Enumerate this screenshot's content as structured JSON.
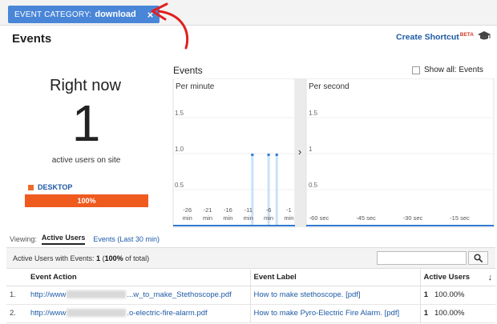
{
  "filter": {
    "key": "EVENT CATEGORY:",
    "value": "download",
    "close": "×"
  },
  "page": {
    "title": "Events",
    "create_shortcut": "Create Shortcut",
    "beta": "BETA"
  },
  "realtime": {
    "right_now": "Right now",
    "count": "1",
    "active_label": "active users on site",
    "device": {
      "label": "DESKTOP",
      "percent_text": "100%",
      "percent": 100
    }
  },
  "chart": {
    "title": "Events",
    "show_all": "Show all: Events",
    "per_minute": "Per minute",
    "per_second": "Per second",
    "expand_glyph": "›",
    "y_ticks": [
      "1.5",
      "1.0",
      "0.5"
    ],
    "minute_ticks": [
      "-26",
      "-21",
      "-16",
      "-11",
      "-6",
      "-1"
    ],
    "minute_unit": "min",
    "second_ticks": [
      "-60 sec",
      "-45 sec",
      "-30 sec",
      "-15 sec"
    ],
    "second_y_ticks": [
      "1.5",
      "1",
      "0.5"
    ],
    "colors": {
      "bar": "#c9e2fb",
      "bar_top": "#2f7bd2",
      "baseline": "#2f7bd2",
      "divider": "#e0e0e0"
    }
  },
  "chart_data": {
    "type": "bar",
    "title": "Events",
    "xlabel": "",
    "ylabel": "",
    "ylim": [
      0,
      1.5
    ],
    "x": [
      -29,
      -28,
      -27,
      -26,
      -25,
      -24,
      -23,
      -22,
      -21,
      -20,
      -19,
      -18,
      -17,
      -16,
      -15,
      -14,
      -13,
      -12,
      -11,
      -10,
      -9,
      -8,
      -7,
      -6,
      -5,
      -4,
      -3,
      -2,
      -1,
      0
    ],
    "values": [
      0,
      0,
      0,
      0,
      0,
      0,
      0,
      0,
      0,
      0,
      0,
      0,
      0,
      0,
      0,
      0,
      0,
      0,
      0,
      1,
      0,
      0,
      0,
      1,
      0,
      1,
      0,
      0,
      0,
      0
    ],
    "x_tick_labels": [
      "-26 min",
      "-21 min",
      "-16 min",
      "-11 min",
      "-6 min",
      "-1 min"
    ],
    "y_tick_labels": [
      "1.5",
      "1.0",
      "0.5"
    ],
    "grid": true
  },
  "viewing": {
    "label": "Viewing:",
    "active_tab": "Active Users",
    "other_tab": "Events (Last 30 min)"
  },
  "summary": {
    "prefix": "Active Users with Events:",
    "count": "1",
    "pct_open": "(",
    "pct": "100%",
    "pct_rest": " of total)"
  },
  "table": {
    "headers": {
      "action": "Event Action",
      "label": "Event Label",
      "users": "Active Users",
      "sort": "↓"
    },
    "rows": [
      {
        "num": "1.",
        "action_a": "http://www",
        "action_b": "...w_to_make_Stethoscope.pdf",
        "label": "How to make stethoscope. [pdf]",
        "users": "1",
        "pct": "100.00%"
      },
      {
        "num": "2.",
        "action_a": "http://www",
        "action_b": ".o-electric-fire-alarm.pdf",
        "label": "How to make Pyro-Electric Fire Alarm. [pdf]",
        "users": "1",
        "pct": "100.00%"
      }
    ]
  }
}
